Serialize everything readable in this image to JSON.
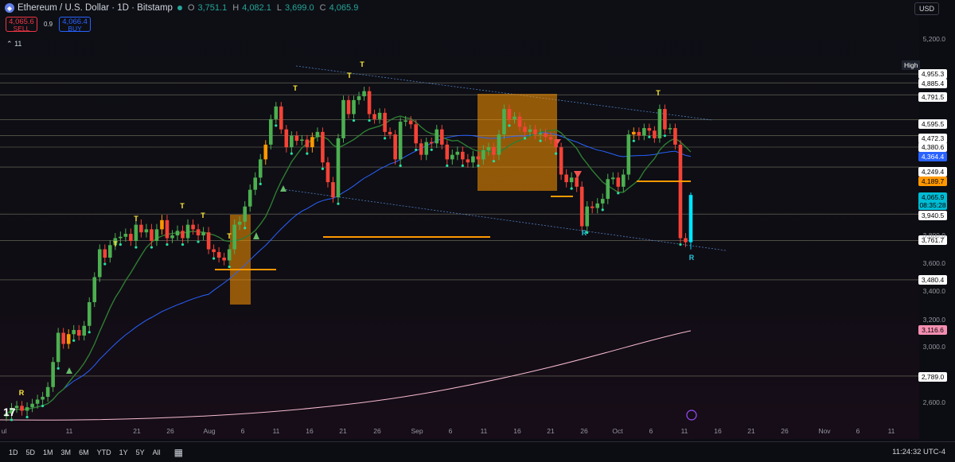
{
  "header": {
    "symbol_title": "Ethereum / U.S. Dollar · 1D · Bitstamp",
    "ohlc": [
      {
        "k": "O",
        "v": "3,751.1"
      },
      {
        "k": "H",
        "v": "4,082.1"
      },
      {
        "k": "L",
        "v": "3,699.0"
      },
      {
        "k": "C",
        "v": "4,065.9"
      }
    ],
    "sell_price": "4,065.6",
    "sell_label": "SELL",
    "spread": "0.9",
    "buy_price": "4,066.4",
    "buy_label": "BUY",
    "indicator_count": "11",
    "currency": "USD"
  },
  "y_axis_labels": [
    "5,200.0",
    "3,800.0",
    "3,600.0",
    "3,400.0",
    "3,200.0",
    "3,000.0",
    "2,600.0"
  ],
  "price_tags": [
    {
      "text": "4,955.3",
      "bg": "#ffffff",
      "fg": "#000000"
    },
    {
      "text": "4,885.4",
      "bg": "#ffffff",
      "fg": "#000000"
    },
    {
      "text": "4,791.5",
      "bg": "#ffffff",
      "fg": "#000000"
    },
    {
      "text": "4,595.5",
      "bg": "#ffffff",
      "fg": "#000000"
    },
    {
      "text": "4,472.3",
      "bg": "#ffffff",
      "fg": "#000000"
    },
    {
      "text": "4,380.6",
      "bg": "#ffffff",
      "fg": "#000000"
    },
    {
      "text": "4,364.4",
      "bg": "#2962ff",
      "fg": "#ffffff"
    },
    {
      "text": "4,249.4",
      "bg": "#ffffff",
      "fg": "#000000"
    },
    {
      "text": "4,189.7",
      "bg": "#ff9800",
      "fg": "#000000"
    },
    {
      "text": "4,065.9",
      "bg": "#00bcd4",
      "fg": "#000000"
    },
    {
      "text": "08:35:28",
      "bg": "#00bcd4",
      "fg": "#000000"
    },
    {
      "text": "3,940.5",
      "bg": "#ffffff",
      "fg": "#000000"
    },
    {
      "text": "3,761.7",
      "bg": "#ffffff",
      "fg": "#000000"
    },
    {
      "text": "3,480.4",
      "bg": "#ffffff",
      "fg": "#000000"
    },
    {
      "text": "3,116.6",
      "bg": "#f48fb1",
      "fg": "#000000"
    },
    {
      "text": "2,789.0",
      "bg": "#ffffff",
      "fg": "#000000"
    }
  ],
  "high_label": "High",
  "x_axis_labels": [
    "ul",
    "11",
    "21",
    "26",
    "Aug",
    "6",
    "11",
    "16",
    "21",
    "26",
    "Sep",
    "6",
    "11",
    "16",
    "21",
    "26",
    "Oct",
    "6",
    "11",
    "16",
    "21",
    "26",
    "Nov",
    "6",
    "11"
  ],
  "timeframes": [
    "1D",
    "5D",
    "1M",
    "3M",
    "6M",
    "YTD",
    "1Y",
    "5Y",
    "All"
  ],
  "clock": "11:24:32 UTC-4",
  "marks": [
    "R",
    "T",
    "T",
    "T",
    "T",
    "T",
    "T",
    "T",
    "T",
    "R",
    "R",
    "T"
  ],
  "logo_text": "17",
  "colors": {
    "up": "#4caf50",
    "down": "#f44336",
    "orange": "#ff9800",
    "current_up": "#00e5ff",
    "ema_blue": "#2962ff",
    "ema_green": "#2e7d32",
    "ema_pink": "#f8bbd0"
  },
  "chart_data": {
    "type": "candlestick",
    "title": "Ethereum / U.S. Dollar · 1D · Bitstamp",
    "last": {
      "open": 3751.1,
      "high": 4082.1,
      "low": 3699.0,
      "close": 4065.9
    },
    "horizontal_levels": [
      4955.3,
      4885.4,
      4791.5,
      4595.5,
      4472.3,
      4380.6,
      4249.4,
      3940.5,
      3761.7,
      3480.4,
      2789.0
    ],
    "moving_averages": [
      {
        "color": "#2962ff",
        "current": 4364.4
      },
      {
        "color": "#ff9800",
        "current": 4189.7
      },
      {
        "color": "#f8bbd0",
        "current": 3116.6
      }
    ],
    "closes": [
      2520,
      2560,
      2575,
      2540,
      2565,
      2590,
      2620,
      2640,
      2710,
      2890,
      3100,
      3020,
      3090,
      3120,
      3080,
      3150,
      3320,
      3500,
      3700,
      3640,
      3730,
      3780,
      3790,
      3810,
      3760,
      3870,
      3820,
      3840,
      3760,
      3840,
      3900,
      3780,
      3800,
      3830,
      3780,
      3870,
      3840,
      3800,
      3820,
      3700,
      3680,
      3640,
      3620,
      3700,
      3870,
      3890,
      3990,
      4100,
      4180,
      4300,
      4400,
      4600,
      4700,
      4520,
      4380,
      4470,
      4430,
      4440,
      4380,
      4460,
      4500,
      4280,
      4150,
      4050,
      4450,
      4750,
      4640,
      4750,
      4780,
      4820,
      4640,
      4600,
      4650,
      4500,
      4480,
      4300,
      4580,
      4590,
      4560,
      4410,
      4330,
      4420,
      4410,
      4520,
      4400,
      4300,
      4330,
      4350,
      4300,
      4280,
      4320,
      4300,
      4360,
      4380,
      4330,
      4480,
      4680,
      4600,
      4620,
      4540,
      4500,
      4520,
      4480,
      4490,
      4460,
      4440,
      4380,
      4200,
      4150,
      4180,
      4120,
      3860,
      3990,
      3980,
      4010,
      4040,
      4170,
      4180,
      4120,
      4200,
      4480,
      4500,
      4470,
      4530,
      4510,
      4450,
      4680,
      4520,
      4530,
      4400,
      3780,
      3751,
      4065.9
    ]
  }
}
